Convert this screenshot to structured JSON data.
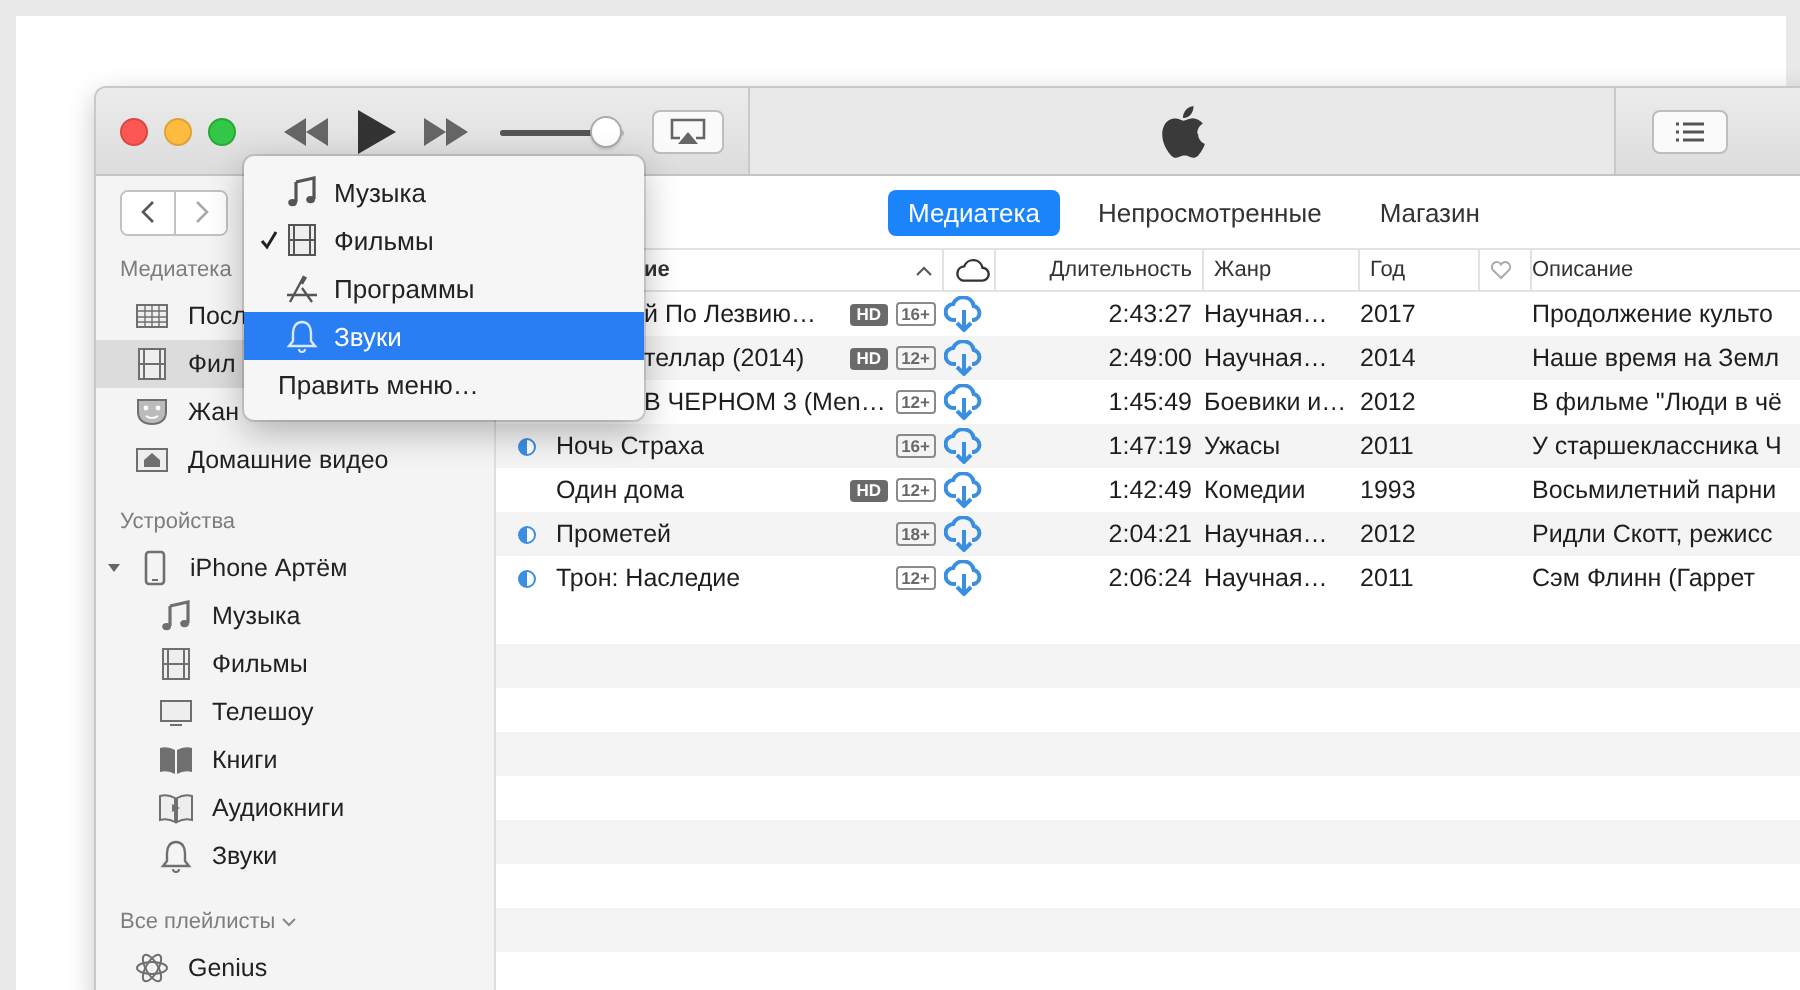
{
  "player": {
    "volume": {
      "level": 0.86
    }
  },
  "tabs": [
    {
      "label": "Медиатека",
      "selected": true
    },
    {
      "label": "Непросмотренные",
      "selected": false
    },
    {
      "label": "Магазин",
      "selected": false
    }
  ],
  "sidebar": {
    "sections": [
      {
        "title": "Медиатека",
        "items": [
          {
            "label": "Посл",
            "kind": "grid",
            "selected": false
          },
          {
            "label": "Фил",
            "kind": "film",
            "selected": true
          },
          {
            "label": "Жан",
            "kind": "masks",
            "selected": false
          },
          {
            "label": "Домашние видео",
            "kind": "home",
            "selected": false
          }
        ]
      },
      {
        "title": "Устройства",
        "items": [
          {
            "label": "iPhone Артём",
            "kind": "phone",
            "selected": false,
            "expanded": true,
            "children": [
              {
                "label": "Музыка",
                "kind": "music",
                "selected": false
              },
              {
                "label": "Фильмы",
                "kind": "film",
                "selected": false
              },
              {
                "label": "Телешоу",
                "kind": "tv",
                "selected": false
              },
              {
                "label": "Книги",
                "kind": "book",
                "selected": false
              },
              {
                "label": "Аудиокниги",
                "kind": "audiobook",
                "selected": false
              },
              {
                "label": "Звуки",
                "kind": "bell",
                "selected": false
              }
            ]
          }
        ]
      },
      {
        "title": "Все плейлисты",
        "collapsible": true,
        "items": [
          {
            "label": "Genius",
            "kind": "atom",
            "selected": false
          }
        ]
      }
    ]
  },
  "table": {
    "columns": [
      {
        "label": "ие"
      },
      {
        "label": "Длительность"
      },
      {
        "label": "Жанр"
      },
      {
        "label": "Год"
      },
      {
        "label": "Описание"
      }
    ],
    "rows": [
      {
        "partly_watched": false,
        "name": "й По Лезвию…",
        "under_menu": true,
        "badges": [
          {
            "text": "HD",
            "kind": "filled"
          },
          {
            "text": "16+",
            "kind": "outline"
          }
        ],
        "duration": "2:43:27",
        "genre": "Научная…",
        "year": "2017",
        "description": "Продолжение культо"
      },
      {
        "partly_watched": false,
        "name": "теллар (2014)",
        "under_menu": true,
        "badges": [
          {
            "text": "HD",
            "kind": "filled"
          },
          {
            "text": "12+",
            "kind": "outline"
          }
        ],
        "duration": "2:49:00",
        "genre": "Научная…",
        "year": "2014",
        "description": "Наше время на Земл"
      },
      {
        "partly_watched": false,
        "name": "В ЧЕРНОМ 3 (Men…",
        "under_menu": true,
        "badges": [
          {
            "text": "12+",
            "kind": "outline"
          }
        ],
        "duration": "1:45:49",
        "genre": "Боевики и…",
        "year": "2012",
        "description": "В фильме \"Люди в чё"
      },
      {
        "partly_watched": true,
        "name": "Ночь Страха",
        "under_menu": false,
        "badges": [
          {
            "text": "16+",
            "kind": "outline"
          }
        ],
        "duration": "1:47:19",
        "genre": "Ужасы",
        "year": "2011",
        "description": "У старшеклассника Ч"
      },
      {
        "partly_watched": false,
        "name": "Один дома",
        "under_menu": false,
        "badges": [
          {
            "text": "HD",
            "kind": "filled"
          },
          {
            "text": "12+",
            "kind": "outline"
          }
        ],
        "duration": "1:42:49",
        "genre": "Комедии",
        "year": "1993",
        "description": "Восьмилетний парни"
      },
      {
        "partly_watched": true,
        "name": "Прометей",
        "under_menu": false,
        "badges": [
          {
            "text": "18+",
            "kind": "outline"
          }
        ],
        "duration": "2:04:21",
        "genre": "Научная…",
        "year": "2012",
        "description": "Ридли Скотт, режисс"
      },
      {
        "partly_watched": true,
        "name": "Трон: Наследие",
        "under_menu": false,
        "badges": [
          {
            "text": "12+",
            "kind": "outline"
          }
        ],
        "duration": "2:06:24",
        "genre": "Научная…",
        "year": "2011",
        "description": "Сэм Флинн (Гаррет"
      }
    ]
  },
  "menu": {
    "items": [
      {
        "label": "Музыка",
        "kind": "music",
        "checked": false,
        "selected": false
      },
      {
        "label": "Фильмы",
        "kind": "film",
        "checked": true,
        "selected": false
      },
      {
        "label": "Программы",
        "kind": "apps",
        "checked": false,
        "selected": false
      },
      {
        "label": "Звуки",
        "kind": "bell",
        "checked": false,
        "selected": true
      }
    ],
    "edit_label": "Править меню…"
  }
}
